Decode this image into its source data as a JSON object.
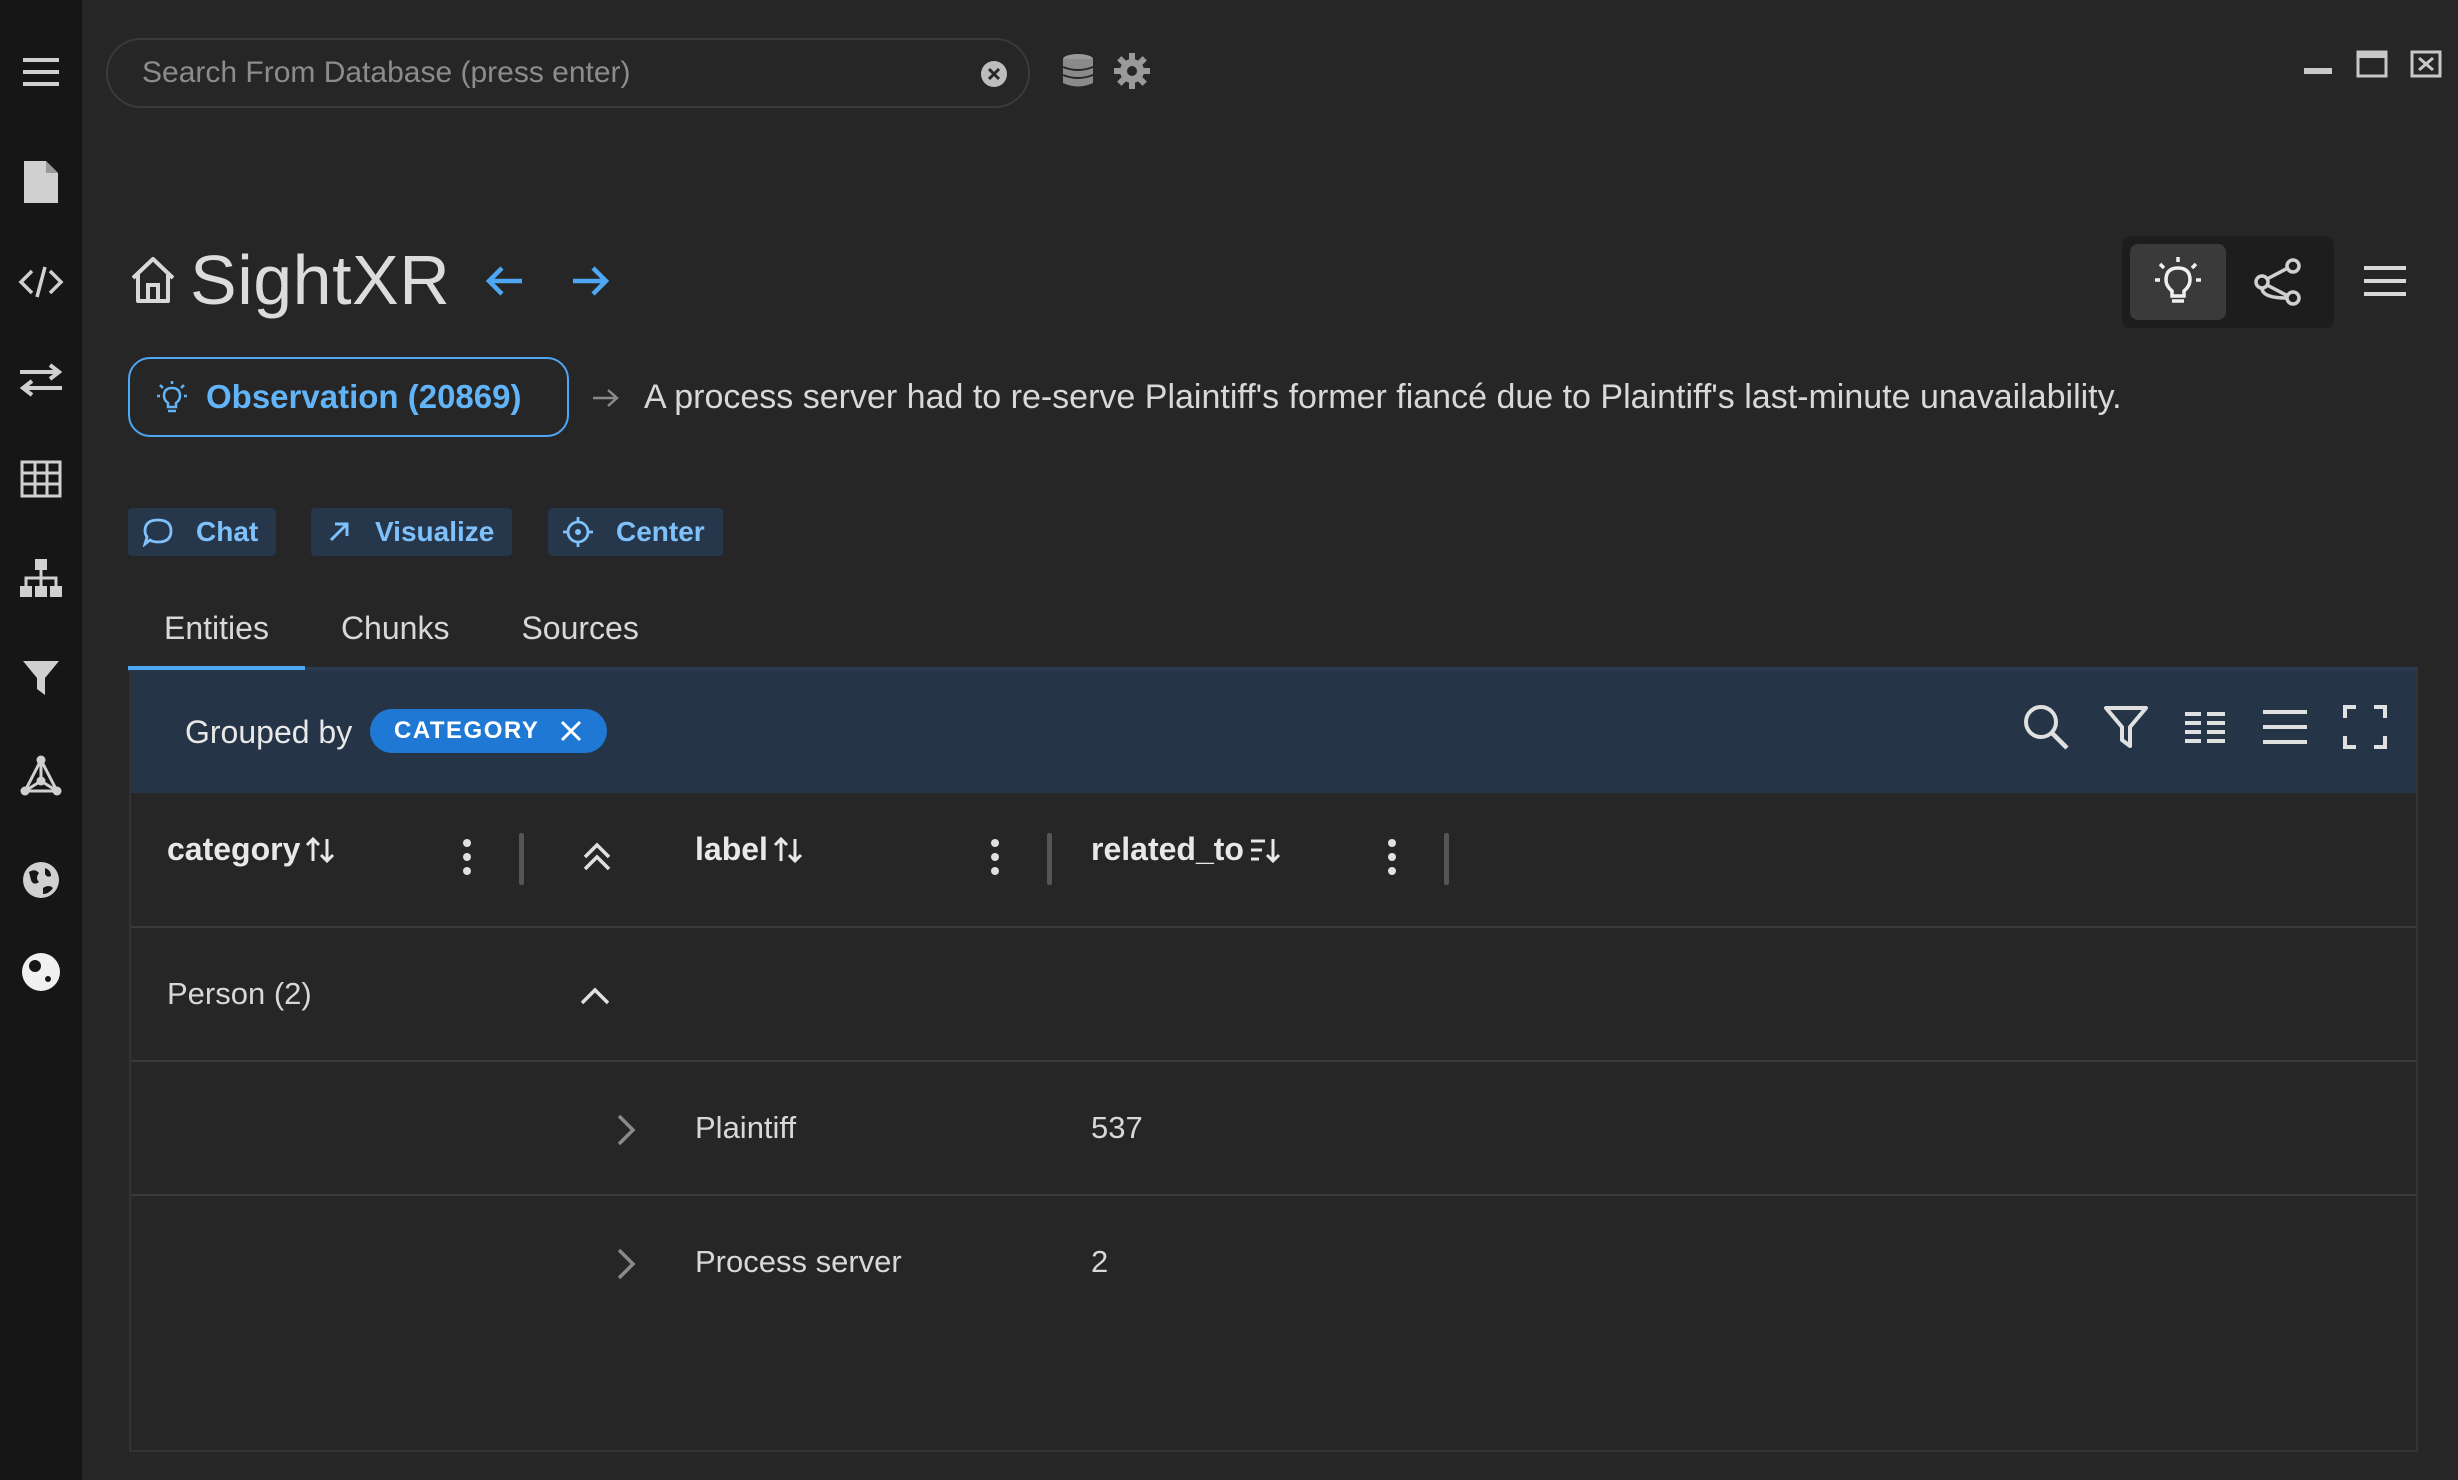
{
  "search": {
    "placeholder": "Search From Database (press enter)"
  },
  "sidebar": {
    "items": [
      {
        "icon": "hamburger-menu-icon"
      },
      {
        "icon": "document-icon"
      },
      {
        "icon": "code-icon"
      },
      {
        "icon": "transfer-arrows-icon"
      },
      {
        "icon": "table-icon"
      },
      {
        "icon": "hierarchy-icon"
      },
      {
        "icon": "filter-icon"
      },
      {
        "icon": "network-graph-icon"
      },
      {
        "icon": "globe-icon"
      },
      {
        "icon": "theme-icon"
      }
    ]
  },
  "header": {
    "title": "SightXR",
    "observation_label": "Observation (20869)",
    "observation_text": "A process server had to re-serve Plaintiff's former fiancé due to Plaintiff's last-minute unavailability."
  },
  "actions": {
    "chat": "Chat",
    "visualize": "Visualize",
    "center": "Center"
  },
  "tabs": [
    {
      "label": "Entities",
      "active": true
    },
    {
      "label": "Chunks",
      "active": false
    },
    {
      "label": "Sources",
      "active": false
    }
  ],
  "toolbar": {
    "grouped_by": "Grouped by",
    "group_chip": "CATEGORY"
  },
  "table": {
    "columns": [
      "category",
      "label",
      "related_to"
    ],
    "group": {
      "label": "Person (2)"
    },
    "rows": [
      {
        "label": "Plaintiff",
        "related_to": "537"
      },
      {
        "label": "Process server",
        "related_to": "2"
      }
    ]
  },
  "colors": {
    "accent": "#4ea7f2",
    "sidebar_bg": "#161616",
    "page_bg": "#262626",
    "toolbar_bg": "#253446",
    "chip_bg": "#1f79d4"
  }
}
